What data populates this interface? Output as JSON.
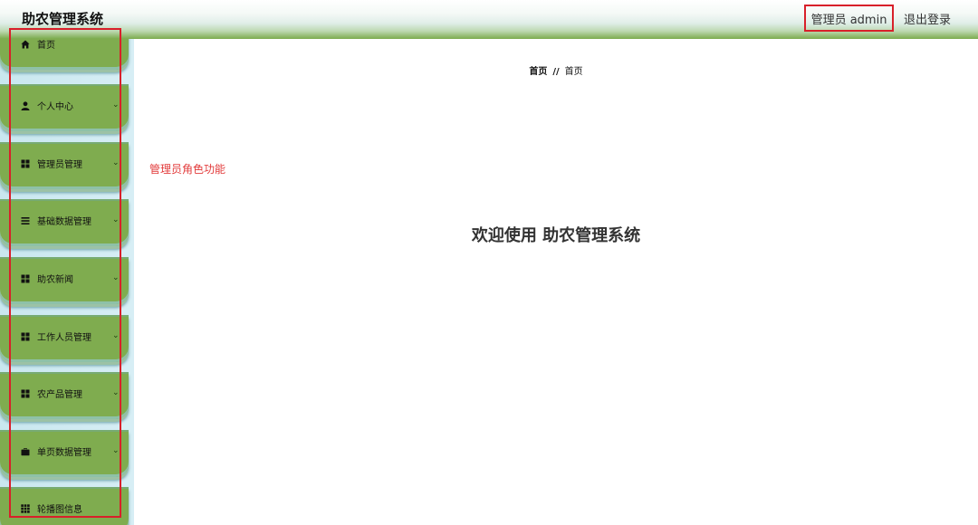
{
  "header": {
    "title": "助农管理系统",
    "user_label": "管理员 admin",
    "logout_label": "退出登录"
  },
  "sidebar": {
    "items": [
      {
        "label": "首页",
        "icon": "home-icon",
        "has_submenu": false
      },
      {
        "label": "个人中心",
        "icon": "user-icon",
        "has_submenu": true
      },
      {
        "label": "管理员管理",
        "icon": "grid-icon",
        "has_submenu": true
      },
      {
        "label": "基础数据管理",
        "icon": "list-icon",
        "has_submenu": true
      },
      {
        "label": "助农新闻",
        "icon": "grid-icon",
        "has_submenu": true
      },
      {
        "label": "工作人员管理",
        "icon": "grid-icon",
        "has_submenu": true
      },
      {
        "label": "农产品管理",
        "icon": "grid-icon",
        "has_submenu": true
      },
      {
        "label": "单页数据管理",
        "icon": "briefcase-icon",
        "has_submenu": true
      },
      {
        "label": "轮播图信息",
        "icon": "grid-nine-icon",
        "has_submenu": false
      }
    ]
  },
  "breadcrumb": {
    "home": "首页",
    "separator": "//",
    "current": "首页"
  },
  "main": {
    "role_text": "管理员角色功能",
    "welcome_text": "欢迎使用 助农管理系统"
  },
  "colors": {
    "accent_green": "#7fac4f",
    "highlight_red": "#d8202a",
    "role_text_red": "#e23b3b"
  }
}
